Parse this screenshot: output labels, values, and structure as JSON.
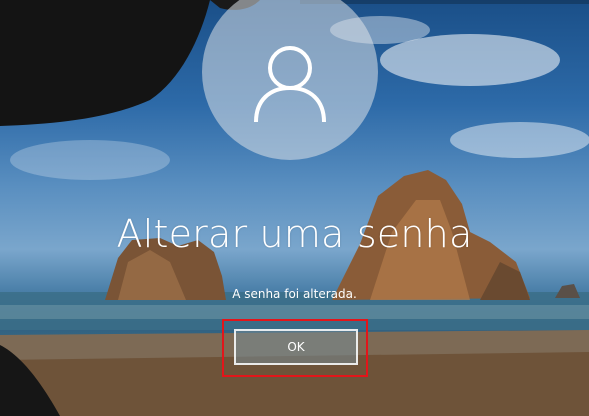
{
  "avatar": {
    "icon": "user-icon"
  },
  "dialog": {
    "title": "Alterar uma senha",
    "message": "A senha foi alterada.",
    "ok_label": "OK"
  },
  "colors": {
    "highlight": "#e3151a",
    "text": "#ffffff"
  }
}
